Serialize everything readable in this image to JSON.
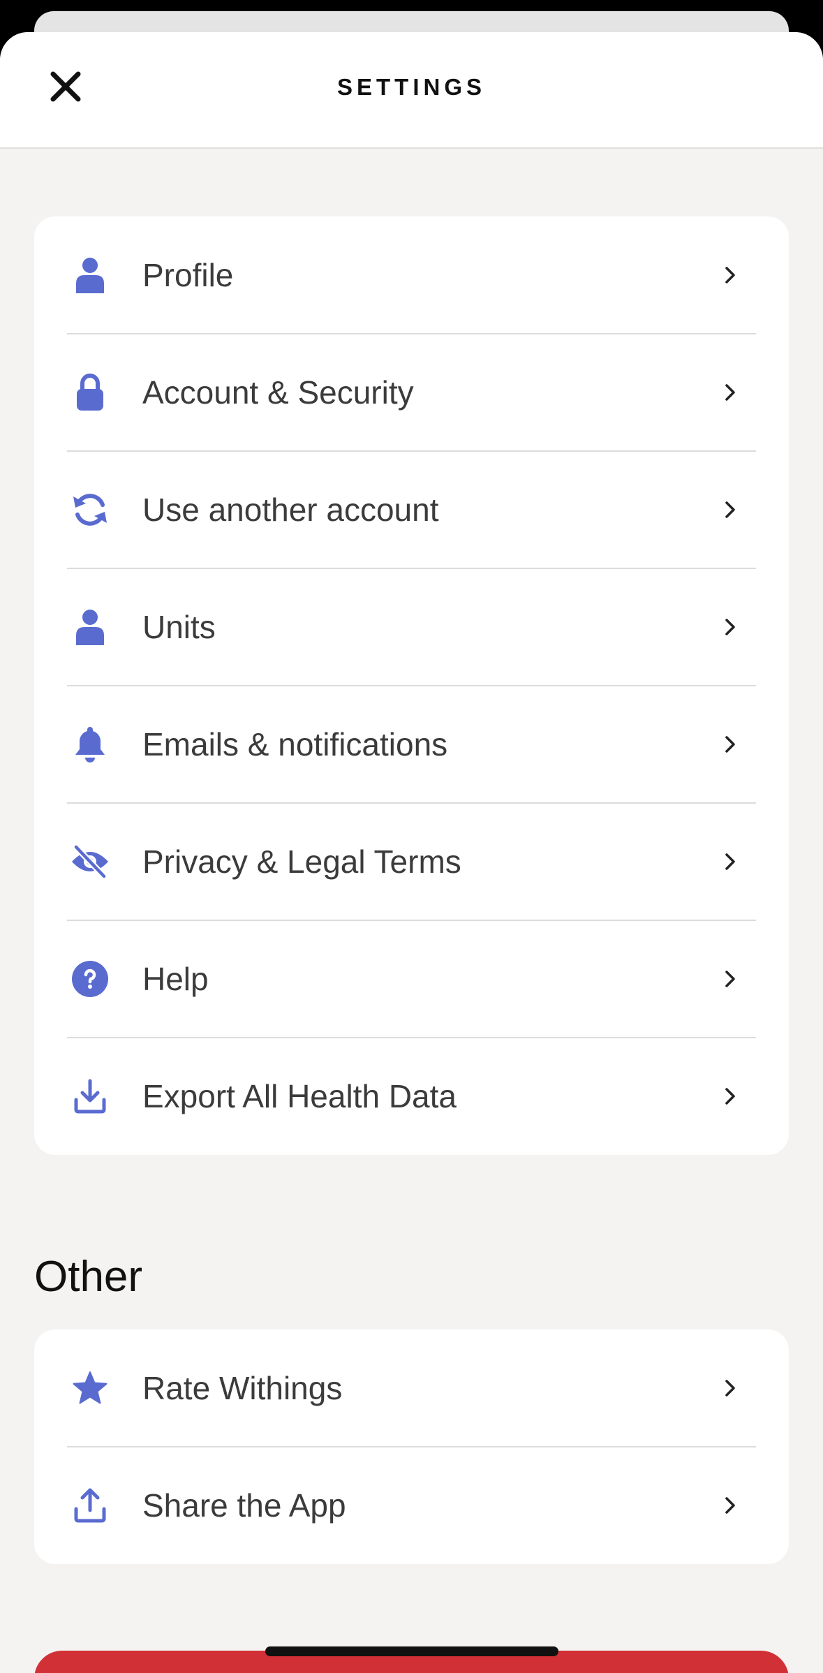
{
  "header": {
    "title": "SETTINGS"
  },
  "colors": {
    "accent": "#5a6bd0",
    "danger": "#d23037"
  },
  "settings": {
    "items": [
      {
        "label": "Profile",
        "icon": "person-icon"
      },
      {
        "label": "Account & Security",
        "icon": "lock-icon"
      },
      {
        "label": "Use another account",
        "icon": "sync-icon"
      },
      {
        "label": "Units",
        "icon": "person-icon"
      },
      {
        "label": "Emails & notifications",
        "icon": "bell-icon"
      },
      {
        "label": "Privacy & Legal Terms",
        "icon": "eye-slash-icon"
      },
      {
        "label": "Help",
        "icon": "question-circle-icon"
      },
      {
        "label": "Export All Health Data",
        "icon": "download-icon"
      }
    ]
  },
  "other": {
    "title": "Other",
    "items": [
      {
        "label": "Rate Withings",
        "icon": "star-icon"
      },
      {
        "label": "Share the App",
        "icon": "share-icon"
      }
    ]
  }
}
